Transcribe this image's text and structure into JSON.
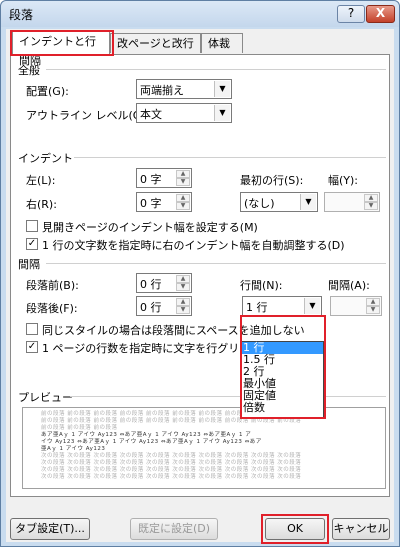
{
  "window": {
    "title": "段落",
    "help_label": "?",
    "close_label": "X"
  },
  "tabs": [
    "インデントと行間隔",
    "改ページと改行",
    "体裁"
  ],
  "general": {
    "heading": "全般",
    "alignment_label": "配置(G):",
    "alignment_value": "両端揃え",
    "outline_label": "アウトライン レベル(O):",
    "outline_value": "本文"
  },
  "indent": {
    "heading": "インデント",
    "left_label": "左(L):",
    "left_value": "0 字",
    "right_label": "右(R):",
    "right_value": "0 字",
    "first_line_label": "最初の行(S):",
    "first_line_value": "(なし)",
    "width_label": "幅(Y):",
    "mirror_label": "見開きページのインデント幅を設定する(M)",
    "mirror_checked": false,
    "auto_adjust_label": "1 行の文字数を指定時に右のインデント幅を自動調整する(D)",
    "auto_adjust_checked": true
  },
  "spacing": {
    "heading": "間隔",
    "before_label": "段落前(B):",
    "before_value": "0 行",
    "after_label": "段落後(F):",
    "after_value": "0 行",
    "line_spacing_label": "行間(N):",
    "line_spacing_value": "1 行",
    "at_label": "間隔(A):",
    "same_style_label": "同じスタイルの場合は段落間にスペースを追加しない",
    "same_style_checked": false,
    "grid_label": "1 ページの行数を指定時に文字を行グリッ",
    "grid_checked": true,
    "line_spacing_options": [
      "1 行",
      "1.5 行",
      "2 行",
      "最小値",
      "固定値",
      "倍数"
    ]
  },
  "preview": {
    "heading": "プレビュー",
    "prev_lines": [
      "前の段落 前の段落 前の段落 前の段落 前の段落 前の段落 前の段落 前の段落 前の段落 前の段落",
      "前の段落 前の段落 前の段落 前の段落 前の段落 前の段落 前の段落 前の段落 前の段落 前の段落",
      "前の段落 前の段落 前の段落"
    ],
    "main_lines": [
      "あア亜Aｙ 1 アイウ Ay123 ⇔あア亜Aｙ 1 アイウ Ay123 ⇔あア亜Aｙ 1 ア",
      "イウ Ay123 ⇔あア亜Aｙ 1 アイウ Ay123 ⇔あア亜Aｙ 1 アイウ Ay123 ⇔あア",
      "亜Aｙ 1 アイウ Ay123"
    ],
    "next_lines": [
      "次の段落 次の段落 次の段落 次の段落 次の段落 次の段落 次の段落 次の段落 次の段落 次の段落",
      "次の段落 次の段落 次の段落 次の段落 次の段落 次の段落 次の段落 次の段落 次の段落 次の段落",
      "次の段落 次の段落 次の段落 次の段落 次の段落 次の段落 次の段落 次の段落 次の段落 次の段落",
      "次の段落 次の段落 次の段落 次の段落 次の段落 次の段落 次の段落 次の段落 次の段落 次の段落"
    ]
  },
  "buttons": {
    "tabs": "タブ設定(T)...",
    "default": "既定に設定(D)",
    "ok": "OK",
    "cancel": "キャンセル"
  },
  "colors": {
    "highlight": "#e0202a",
    "selection": "#3399ff",
    "window_frame": "#c9dcef"
  }
}
